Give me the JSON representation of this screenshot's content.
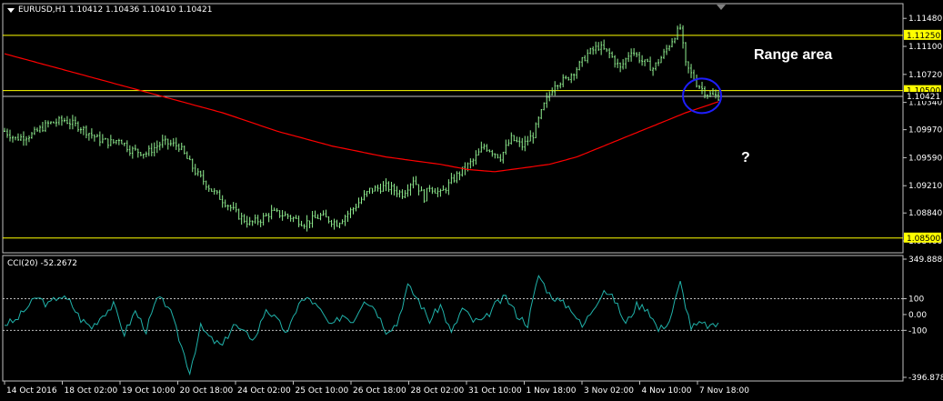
{
  "window": {
    "main_title": "EURUSD,H1  1.10412 1.10436 1.10410 1.10421",
    "indicator_title": "CCI(20) -52.2672"
  },
  "annotations": {
    "range_label": "Range area",
    "question_mark": "?"
  },
  "colors": {
    "background": "#000000",
    "frame": "#c0c0c0",
    "candles": "#90ee90",
    "moving_average": "#ff0000",
    "level_lines": "#ffff00",
    "current_price_line": "#c0c0c0",
    "cci_line": "#20b2aa",
    "circle": "#1e1eff",
    "label_bg": "#ffff00"
  },
  "chart_data": [
    {
      "type": "candlestick",
      "symbol": "EURUSD",
      "timeframe": "H1",
      "title": "EURUSD,H1  1.10412 1.10436 1.10410 1.10421",
      "ylim": [
        1.083,
        1.1168
      ],
      "y_ticks": [
        "1.11480",
        "1.11100",
        "1.10720",
        "1.10340",
        "1.09970",
        "1.09590",
        "1.09210",
        "1.08840",
        "1.08460"
      ],
      "y_tick_values": [
        1.1148,
        1.111,
        1.1072,
        1.1034,
        1.0997,
        1.0959,
        1.0921,
        1.0884,
        1.0846
      ],
      "x_ticks": [
        "14 Oct 2016",
        "18 Oct 02:00",
        "19 Oct 10:00",
        "20 Oct 18:00",
        "24 Oct 02:00",
        "25 Oct 10:00",
        "26 Oct 18:00",
        "28 Oct 02:00",
        "31 Oct 10:00",
        "1 Nov 18:00",
        "3 Nov 02:00",
        "4 Nov 10:00",
        "7 Nov 18:00"
      ],
      "levels": [
        {
          "value": 1.1125,
          "label": "1.11250"
        },
        {
          "value": 1.105,
          "label": "1.10500"
        },
        {
          "value": 1.085,
          "label": "1.08500"
        }
      ],
      "current_price": {
        "value": 1.10421,
        "label": "1.10421"
      },
      "price_path": {
        "bar_index": [
          0,
          4,
          10,
          16,
          22,
          28,
          34,
          38,
          40,
          42,
          46,
          52,
          58,
          64,
          70,
          76,
          82,
          86,
          90,
          94,
          98,
          104,
          110,
          116,
          122,
          128,
          134,
          140,
          146,
          150,
          154,
          156,
          160,
          166,
          172,
          176,
          182,
          186,
          190,
          194,
          198,
          202,
          206,
          210,
          214,
          218,
          222,
          226,
          230,
          234,
          238,
          242,
          246,
          248,
          250,
          254,
          258,
          262
        ],
        "close": [
          1.0995,
          1.0985,
          1.099,
          1.1005,
          1.101,
          1.1,
          1.0985,
          1.098,
          1.098,
          1.0985,
          1.097,
          1.0965,
          1.098,
          1.0975,
          1.094,
          1.0915,
          1.0895,
          1.088,
          1.087,
          1.0875,
          1.0885,
          1.088,
          1.087,
          1.088,
          1.087,
          1.089,
          1.0915,
          1.092,
          1.091,
          1.093,
          1.0905,
          1.092,
          1.091,
          1.0935,
          1.0955,
          1.0975,
          1.096,
          1.0985,
          1.0975,
          1.099,
          1.103,
          1.106,
          1.1065,
          1.108,
          1.11,
          1.111,
          1.11,
          1.108,
          1.1105,
          1.109,
          1.108,
          1.11,
          1.1125,
          1.1135,
          1.1085,
          1.106,
          1.1045,
          1.1042
        ]
      },
      "moving_average": {
        "bar_index": [
          0,
          20,
          40,
          60,
          80,
          100,
          120,
          140,
          150,
          160,
          170,
          180,
          190,
          200,
          210,
          220,
          230,
          240,
          250,
          262
        ],
        "value": [
          1.11,
          1.108,
          1.106,
          1.104,
          1.102,
          1.0995,
          1.0975,
          1.096,
          1.0955,
          1.095,
          1.0943,
          1.094,
          1.0945,
          1.095,
          1.096,
          1.0975,
          1.099,
          1.1005,
          1.102,
          1.1035
        ]
      }
    },
    {
      "type": "line",
      "title": "CCI(20) -52.2672",
      "ylim": [
        -396.8782,
        349.8886
      ],
      "y_ticks": [
        "349.8886",
        "100",
        "0.00",
        "-100",
        "-396.8782"
      ],
      "y_tick_values": [
        349.8886,
        100,
        0,
        -100,
        -396.8782
      ],
      "levels": [
        100,
        -100
      ],
      "series": [
        {
          "x": [
            0,
            4,
            8,
            12,
            16,
            20,
            24,
            28,
            32,
            36,
            40,
            44,
            48,
            52,
            56,
            60,
            64,
            68,
            72,
            76,
            80,
            84,
            88,
            92,
            96,
            100,
            104,
            108,
            112,
            116,
            120,
            124,
            128,
            132,
            136,
            140,
            144,
            148,
            152,
            156,
            160,
            164,
            168,
            172,
            176,
            180,
            184,
            188,
            192,
            196,
            200,
            204,
            208,
            212,
            216,
            220,
            224,
            228,
            232,
            236,
            240,
            244,
            248,
            252,
            256,
            260,
            262
          ],
          "y": [
            -60,
            -40,
            40,
            110,
            60,
            120,
            80,
            -30,
            -80,
            0,
            60,
            -120,
            20,
            -100,
            100,
            60,
            -150,
            -360,
            -80,
            -160,
            -200,
            -60,
            -120,
            -150,
            40,
            -40,
            -120,
            80,
            100,
            20,
            -80,
            0,
            -40,
            100,
            40,
            -100,
            -60,
            180,
            90,
            -40,
            60,
            -120,
            40,
            -40,
            -40,
            60,
            110,
            0,
            -60,
            250,
            130,
            80,
            40,
            -80,
            40,
            160,
            90,
            -60,
            60,
            40,
            -100,
            -40,
            200,
            -80,
            -60,
            -80,
            -52.27
          ]
        }
      ]
    }
  ]
}
